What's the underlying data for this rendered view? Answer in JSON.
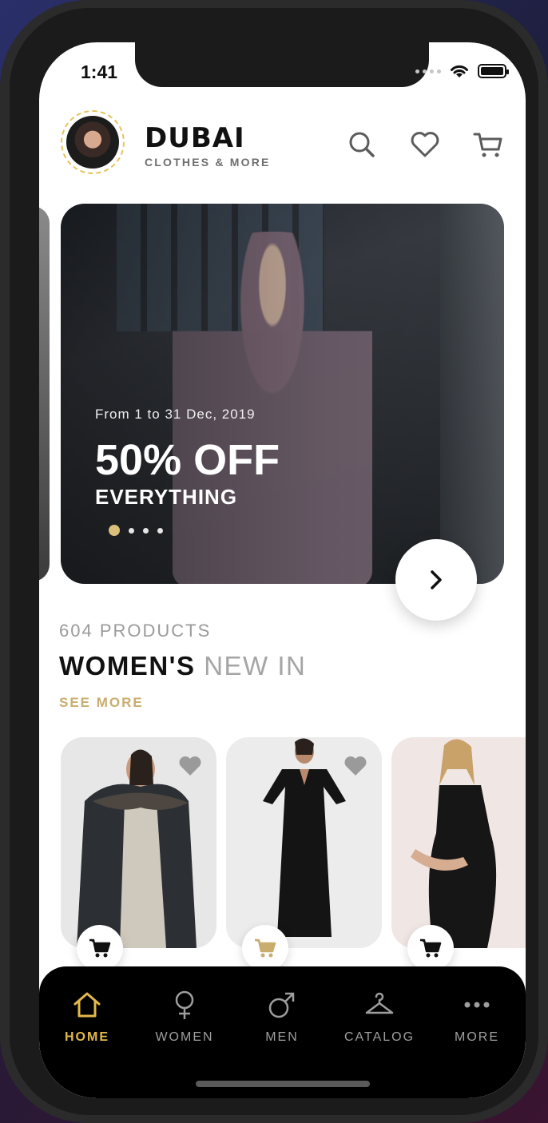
{
  "status_bar": {
    "time": "1:41"
  },
  "header": {
    "brand_name": "DUBAI",
    "brand_tagline": "CLOTHES & MORE",
    "icons": [
      "search-icon",
      "heart-icon",
      "cart-icon"
    ]
  },
  "banner": {
    "date_text": "From 1 to 31 Dec, 2019",
    "headline": "50% OFF",
    "subheadline": "EVERYTHING",
    "slide_count": 4,
    "active_slide": 1
  },
  "section": {
    "product_count": "604 PRODUCTS",
    "title_bold": "WOMEN'S",
    "title_light": "NEW IN",
    "see_more": "SEE MORE"
  },
  "products": [
    {
      "name": "product-coat",
      "cart_active": false
    },
    {
      "name": "product-black-maxi-dress",
      "cart_active": true
    },
    {
      "name": "product-maternity-dress",
      "cart_active": false
    }
  ],
  "tabbar": {
    "items": [
      {
        "label": "HOME",
        "icon": "home-icon",
        "active": true
      },
      {
        "label": "WOMEN",
        "icon": "female-symbol-icon",
        "active": false
      },
      {
        "label": "MEN",
        "icon": "male-symbol-icon",
        "active": false
      },
      {
        "label": "CATALOG",
        "icon": "hanger-icon",
        "active": false
      },
      {
        "label": "MORE",
        "icon": "more-dots-icon",
        "active": false
      }
    ]
  },
  "colors": {
    "accent_gold": "#c8ad6e",
    "tab_active": "#e4b94a",
    "text_dark": "#111111",
    "text_muted": "#a5a5a5"
  }
}
